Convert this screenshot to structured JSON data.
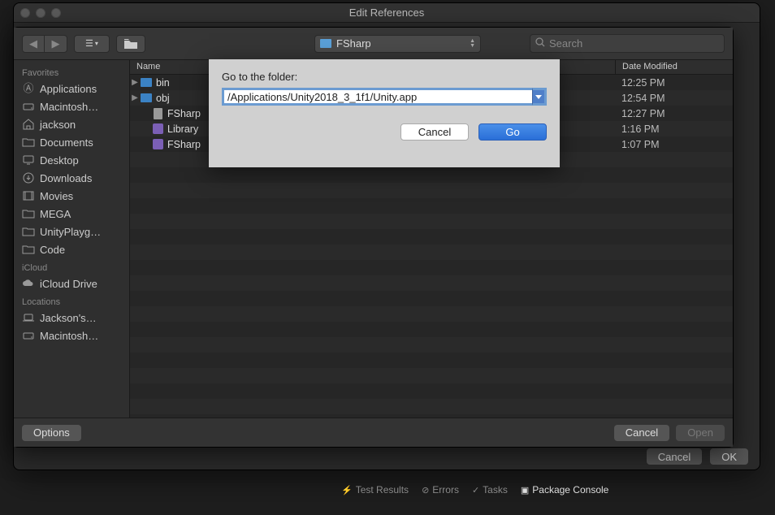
{
  "window": {
    "title": "Edit References"
  },
  "toolbar": {
    "path_label": "FSharp",
    "search_placeholder": "Search"
  },
  "sidebar": {
    "sections": [
      {
        "heading": "Favorites",
        "items": [
          {
            "icon": "apps",
            "label": "Applications"
          },
          {
            "icon": "disk",
            "label": "Macintosh…"
          },
          {
            "icon": "home",
            "label": "jackson"
          },
          {
            "icon": "folder",
            "label": "Documents"
          },
          {
            "icon": "desktop",
            "label": "Desktop"
          },
          {
            "icon": "downloads",
            "label": "Downloads"
          },
          {
            "icon": "movies",
            "label": "Movies"
          },
          {
            "icon": "folder",
            "label": "MEGA"
          },
          {
            "icon": "folder",
            "label": "UnityPlayg…"
          },
          {
            "icon": "folder",
            "label": "Code"
          }
        ]
      },
      {
        "heading": "iCloud",
        "items": [
          {
            "icon": "cloud",
            "label": "iCloud Drive"
          }
        ]
      },
      {
        "heading": "Locations",
        "items": [
          {
            "icon": "laptop",
            "label": "Jackson's…"
          },
          {
            "icon": "disk",
            "label": "Macintosh…"
          }
        ]
      }
    ]
  },
  "list": {
    "columns": {
      "name": "Name",
      "date": "Date Modified"
    },
    "rows": [
      {
        "type": "folder",
        "name": "bin",
        "date": "12:25 PM",
        "expandable": true
      },
      {
        "type": "folder",
        "name": "obj",
        "date": "12:54 PM",
        "expandable": true
      },
      {
        "type": "doc",
        "name": "FSharp",
        "date": "12:27 PM",
        "expandable": false,
        "indent": 1
      },
      {
        "type": "proj",
        "name": "Library",
        "date": "1:16 PM",
        "expandable": false,
        "indent": 1
      },
      {
        "type": "proj",
        "name": "FSharp",
        "date": "1:07 PM",
        "expandable": false,
        "indent": 1
      }
    ]
  },
  "footer": {
    "options": "Options",
    "cancel": "Cancel",
    "open": "Open"
  },
  "goto": {
    "label": "Go to the folder:",
    "value": "/Applications/Unity2018_3_1f1/Unity.app",
    "cancel": "Cancel",
    "go": "Go"
  },
  "outer_footer": {
    "cancel": "Cancel",
    "ok": "OK"
  },
  "bottom_tabs": {
    "results": "Test Results",
    "errors": "Errors",
    "tasks": "Tasks",
    "console": "Package Console"
  }
}
